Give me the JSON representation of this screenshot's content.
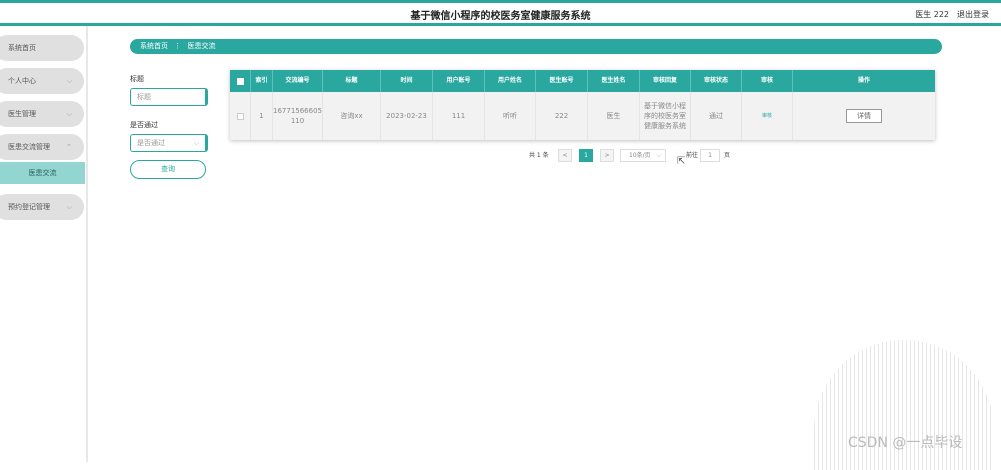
{
  "header": {
    "title": "基于微信小程序的校医务室健康服务系统",
    "user": "医生 222",
    "logout": "退出登录"
  },
  "sidebar": {
    "items": [
      {
        "label": "系统首页"
      },
      {
        "label": "个人中心"
      },
      {
        "label": "医生管理"
      },
      {
        "label": "医患交流管理"
      },
      {
        "label": "预约登记管理"
      }
    ],
    "sub_item": "医患交流"
  },
  "breadcrumb": {
    "home": "系统首页",
    "current": "医患交流"
  },
  "filters": {
    "title_label": "标题",
    "title_placeholder": "标题",
    "passed_label": "是否通过",
    "passed_placeholder": "是否通过",
    "query_button": "查询"
  },
  "table": {
    "headers": [
      "索引",
      "交流编号",
      "标题",
      "时间",
      "用户账号",
      "用户姓名",
      "医生账号",
      "医生姓名",
      "审核回复",
      "审核状态",
      "审核",
      "操作"
    ],
    "rows": [
      {
        "index": "1",
        "code_line1": "16771566605",
        "code_line2": "110",
        "title": "咨询xx",
        "time": "2023-02-23",
        "user_account": "111",
        "user_name": "听听",
        "doctor_account": "222",
        "doctor_name": "医生",
        "reply_line1": "基于微信小程",
        "reply_line2": "序的校医务室",
        "reply_line3": "健康服务系统",
        "status": "通过",
        "review_badge": "审核",
        "action": "详情"
      }
    ]
  },
  "pagination": {
    "total": "共 1 条",
    "prev": "<",
    "current_page": "1",
    "next": ">",
    "page_size": "10条/页",
    "goto_label": "前往",
    "goto_value": "1",
    "page_unit": "页"
  },
  "watermark": "CSDN @一点毕设"
}
